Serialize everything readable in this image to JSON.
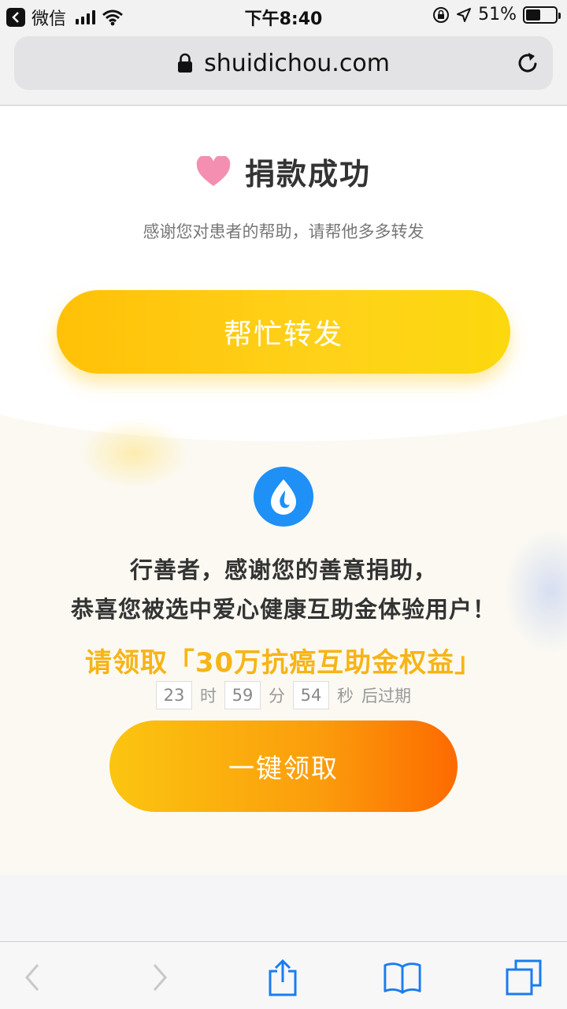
{
  "status_bar": {
    "back_app": "微信",
    "time": "下午8:40",
    "battery_percent": "51%",
    "battery_level": 0.51
  },
  "url_bar": {
    "domain": "shuidichou.com"
  },
  "success": {
    "title": "捐款成功",
    "thanks": "感谢您对患者的帮助，请帮他多多转发",
    "share_button": "帮忙转发"
  },
  "promo": {
    "line1": "行善者，感谢您的善意捐助，",
    "line2": "恭喜您被选中爱心健康互助金体验用户！",
    "offer": "请领取「30万抗癌互助金权益」",
    "countdown": {
      "hours": "23",
      "hours_label": "时",
      "minutes": "59",
      "minutes_label": "分",
      "seconds": "54",
      "seconds_label": "秒",
      "suffix": "后过期"
    },
    "claim_button": "一键领取"
  },
  "colors": {
    "accent_yellow": "#ffc107",
    "offer_text": "#f7b416",
    "claim_gradient_end": "#fd6a00",
    "logo_blue": "#1e90f6",
    "heart_pink": "#f48fb1",
    "toolbar_blue": "#1a7cf0"
  },
  "icons": {
    "heart": "heart-icon",
    "lock": "lock-icon",
    "reload": "reload-icon",
    "logo": "water-drop-logo",
    "back": "back-arrow-icon",
    "forward": "forward-arrow-icon",
    "share": "share-icon",
    "bookmarks": "bookmarks-icon",
    "tabs": "tabs-icon"
  }
}
